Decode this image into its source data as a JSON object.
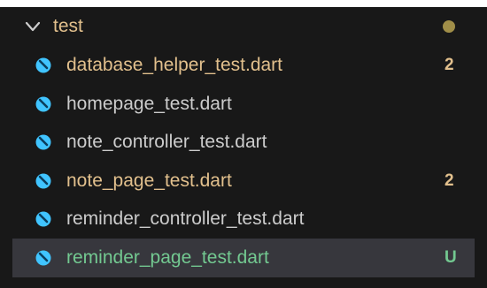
{
  "folder": {
    "name": "test",
    "status_color": "#a08e48",
    "label_color": "#e2c08d"
  },
  "files": [
    {
      "name": "database_helper_test.dart",
      "badge": "2",
      "color": "#e2c08d",
      "badge_color": "#e2c08d",
      "icon": "dart-icon"
    },
    {
      "name": "homepage_test.dart",
      "badge": "",
      "color": "#cccccc",
      "badge_color": "#cccccc",
      "icon": "dart-icon"
    },
    {
      "name": "note_controller_test.dart",
      "badge": "",
      "color": "#cccccc",
      "badge_color": "#cccccc",
      "icon": "dart-icon"
    },
    {
      "name": "note_page_test.dart",
      "badge": "2",
      "color": "#e2c08d",
      "badge_color": "#e2c08d",
      "icon": "dart-icon"
    },
    {
      "name": "reminder_controller_test.dart",
      "badge": "",
      "color": "#cccccc",
      "badge_color": "#cccccc",
      "icon": "dart-icon"
    },
    {
      "name": "reminder_page_test.dart",
      "badge": "U",
      "color": "#73c991",
      "badge_color": "#73c991",
      "icon": "dart-icon",
      "selected": true
    }
  ],
  "colors": {
    "background": "#181818",
    "selected_background": "#37373d",
    "dart_icon": "#40c4ff"
  }
}
